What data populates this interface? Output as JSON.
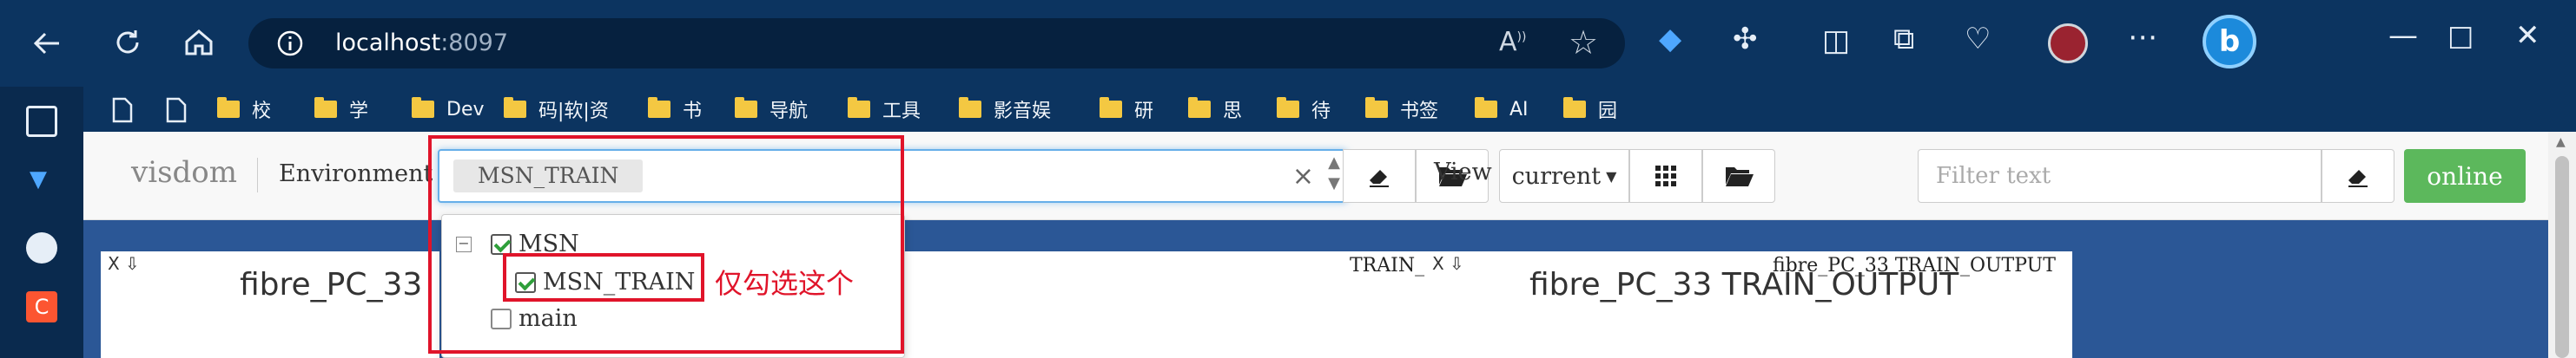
{
  "browser": {
    "address": {
      "host": "localhost",
      "port": ":8097"
    },
    "favorites": [
      {
        "label": "校"
      },
      {
        "label": "学"
      },
      {
        "label": "Dev"
      },
      {
        "label": "码|软|资"
      },
      {
        "label": "书"
      },
      {
        "label": "导航"
      },
      {
        "label": "工具"
      },
      {
        "label": "影音娱"
      },
      {
        "label": "研"
      },
      {
        "label": "思"
      },
      {
        "label": "待"
      },
      {
        "label": "书签"
      },
      {
        "label": "AI"
      },
      {
        "label": "园"
      }
    ]
  },
  "navbar": {
    "logo": "visdom",
    "env_label": "Environment",
    "selected_env": "MSN_TRAIN",
    "view_label": "View",
    "view_value": "current",
    "filter_placeholder": "Filter text",
    "online_label": "online"
  },
  "dropdown": {
    "parent": {
      "label": "MSN",
      "checked": true
    },
    "child": {
      "label": "MSN_TRAIN",
      "checked": true
    },
    "other": {
      "label": "main",
      "checked": false
    }
  },
  "annotation": {
    "note": "仅勾选这个"
  },
  "panes": [
    {
      "close": "X ⇩",
      "title_big": "fibre_PC_33"
    },
    {
      "title_small": "TRAIN_INPUT"
    },
    {
      "close": "X ⇩",
      "title_small": "fibre_PC_33 TRAIN_OUTPUT",
      "title_big": "fibre_PC_33  TRAIN_OUTPUT"
    }
  ],
  "colors": {
    "accent_green": "#5cb85c",
    "annotation_red": "#e0142a",
    "content_bg": "#2b5796"
  }
}
